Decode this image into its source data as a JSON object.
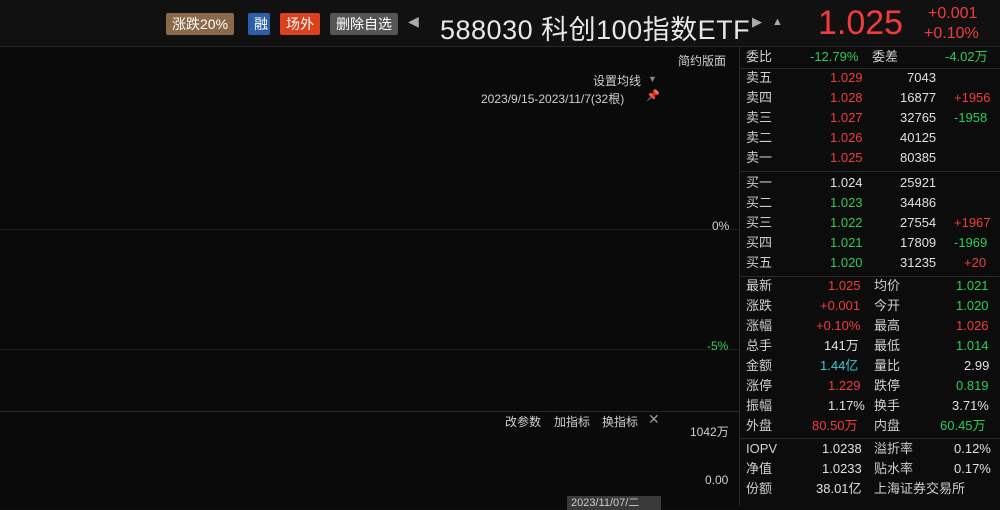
{
  "header": {
    "tag_limit": "涨跌20%",
    "tag_margin": "融",
    "tag_exchange": "场外",
    "tag_delete": "删除自选",
    "title": "588030 科创100指数ETF",
    "price": "1.025",
    "change_abs": "+0.001",
    "change_pct": "+0.10%",
    "prev_icon": "triangle-left-icon",
    "next_icon": "triangle-right-icon",
    "bell_icon": "bell-icon"
  },
  "chart": {
    "simple_version": "简约版面",
    "ma_setting": "设置均线",
    "range": "2023/9/15-2023/11/7(32根)",
    "y_zero": "0%",
    "y_minus5": "-5%",
    "vol_top": "1042万",
    "vol_zero": "0.00",
    "btn_params": "改参数",
    "btn_add": "加指标",
    "btn_switch": "换指标",
    "close_icon": "close-icon",
    "date_tip": "2023/11/07/二"
  },
  "orderbook": {
    "wei_bi_label": "委比",
    "wei_bi_value": "-12.79%",
    "wei_cha_label": "委差",
    "wei_cha_value": "-4.02万",
    "asks": [
      {
        "label": "卖五",
        "price": "1.029",
        "vol": "7043",
        "chg": ""
      },
      {
        "label": "卖四",
        "price": "1.028",
        "vol": "16877",
        "chg": "+1956"
      },
      {
        "label": "卖三",
        "price": "1.027",
        "vol": "32765",
        "chg": "-1958"
      },
      {
        "label": "卖二",
        "price": "1.026",
        "vol": "40125",
        "chg": ""
      },
      {
        "label": "卖一",
        "price": "1.025",
        "vol": "80385",
        "chg": ""
      }
    ],
    "bids": [
      {
        "label": "买一",
        "price": "1.024",
        "vol": "25921",
        "chg": ""
      },
      {
        "label": "买二",
        "price": "1.023",
        "vol": "34486",
        "chg": ""
      },
      {
        "label": "买三",
        "price": "1.022",
        "vol": "27554",
        "chg": "+1967"
      },
      {
        "label": "买四",
        "price": "1.021",
        "vol": "17809",
        "chg": "-1969"
      },
      {
        "label": "买五",
        "price": "1.020",
        "vol": "31235",
        "chg": "+20"
      }
    ]
  },
  "stats": [
    {
      "l1": "最新",
      "v1": "1.025",
      "l2": "均价",
      "v2": "1.021"
    },
    {
      "l1": "涨跌",
      "v1": "+0.001",
      "l2": "今开",
      "v2": "1.020"
    },
    {
      "l1": "涨幅",
      "v1": "+0.10%",
      "l2": "最高",
      "v2": "1.026"
    },
    {
      "l1": "总手",
      "v1": "141万",
      "l2": "最低",
      "v2": "1.014"
    },
    {
      "l1": "金额",
      "v1": "1.44亿",
      "l2": "量比",
      "v2": "2.99"
    },
    {
      "l1": "涨停",
      "v1": "1.229",
      "l2": "跌停",
      "v2": "0.819"
    },
    {
      "l1": "振幅",
      "v1": "1.17%",
      "l2": "换手",
      "v2": "3.71%"
    },
    {
      "l1": "外盘",
      "v1": "80.50万",
      "l2": "内盘",
      "v2": "60.45万"
    },
    {
      "l1": "IOPV",
      "v1": "1.0238",
      "l2": "溢折率",
      "v2": "0.12%"
    },
    {
      "l1": "净值",
      "v1": "1.0233",
      "l2": "贴水率",
      "v2": "0.17%"
    },
    {
      "l1": "份额",
      "v1": "38.01亿",
      "l2": "上海证券交易所",
      "v2": ""
    }
  ],
  "colors": {
    "up": "#f23c3c",
    "down": "#2ecc55",
    "neutral": "#e0e0e0",
    "cyan": "#3dc8d8"
  }
}
